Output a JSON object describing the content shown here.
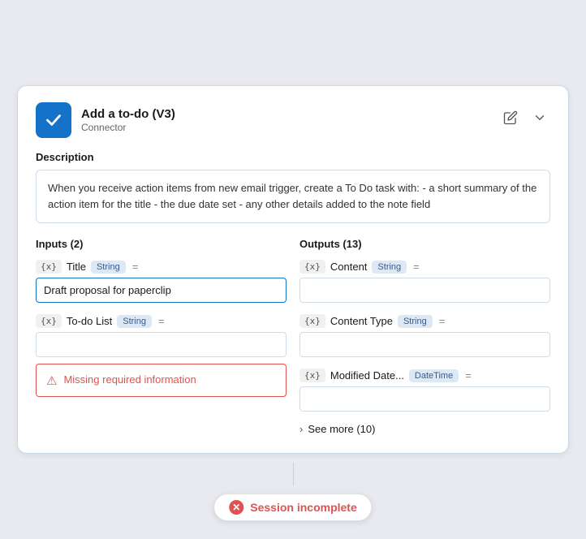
{
  "header": {
    "title": "Add a to-do (V3)",
    "subtitle": "Connector",
    "edit_icon": "✎",
    "collapse_icon": "˅"
  },
  "description": {
    "label": "Description",
    "text": "When you receive action items from new email trigger, create a To Do task with: - a short summary of the action item for the title - the due date set - any other details added to the note field"
  },
  "inputs": {
    "section_title": "Inputs (2)",
    "items": [
      {
        "var_badge": "{x}",
        "label": "Title",
        "type": "String",
        "eq": "=",
        "value": "Draft proposal for paperclip",
        "has_value": true,
        "error": false
      },
      {
        "var_badge": "{x}",
        "label": "To-do List",
        "type": "String",
        "eq": "=",
        "value": "",
        "has_value": false,
        "error": true,
        "error_text": "Missing required information"
      }
    ]
  },
  "outputs": {
    "section_title": "Outputs (13)",
    "items": [
      {
        "var_badge": "{x}",
        "label": "Content",
        "type": "String",
        "eq": "=",
        "value": ""
      },
      {
        "var_badge": "{x}",
        "label": "Content Type",
        "type": "String",
        "eq": "=",
        "value": ""
      },
      {
        "var_badge": "{x}",
        "label": "Modified Date...",
        "type": "DateTime",
        "eq": "=",
        "value": ""
      }
    ],
    "see_more_label": "See more (10)"
  },
  "session_badge": {
    "icon": "✕",
    "text": "Session incomplete"
  }
}
